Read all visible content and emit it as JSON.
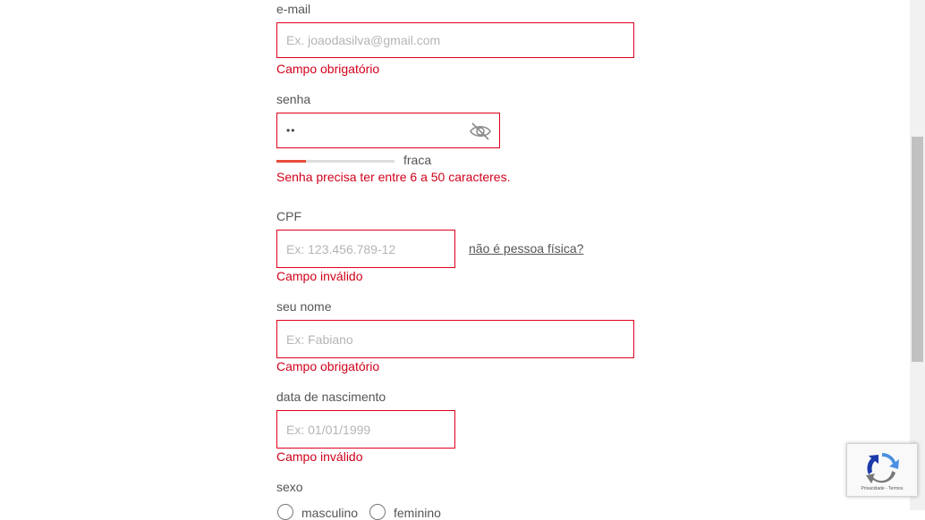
{
  "email": {
    "label": "e-mail",
    "placeholder": "Ex. joaodasilva@gmail.com",
    "error": "Campo obrigatório"
  },
  "password": {
    "label": "senha",
    "masked_value": "••",
    "strength_label": "fraca",
    "strength_level": 0.25,
    "error": "Senha precisa ter entre 6 a 50 caracteres."
  },
  "cpf": {
    "label": "CPF",
    "placeholder": "Ex: 123.456.789-12",
    "alt_link": "não é pessoa física?",
    "error": "Campo inválido"
  },
  "name": {
    "label": "seu nome",
    "placeholder": "Ex: Fabiano",
    "error": "Campo obrigatório"
  },
  "birthdate": {
    "label": "data de nascimento",
    "placeholder": "Ex: 01/01/1999",
    "error": "Campo inválido"
  },
  "gender": {
    "label": "sexo",
    "options": [
      "masculino",
      "feminino"
    ]
  },
  "recaptcha": {
    "privacy": "Privacidade",
    "separator": " - ",
    "terms": "Termos"
  },
  "colors": {
    "error": "#d0021b",
    "field_border": "#e0001b",
    "strength_fill": "#e74c3c"
  }
}
